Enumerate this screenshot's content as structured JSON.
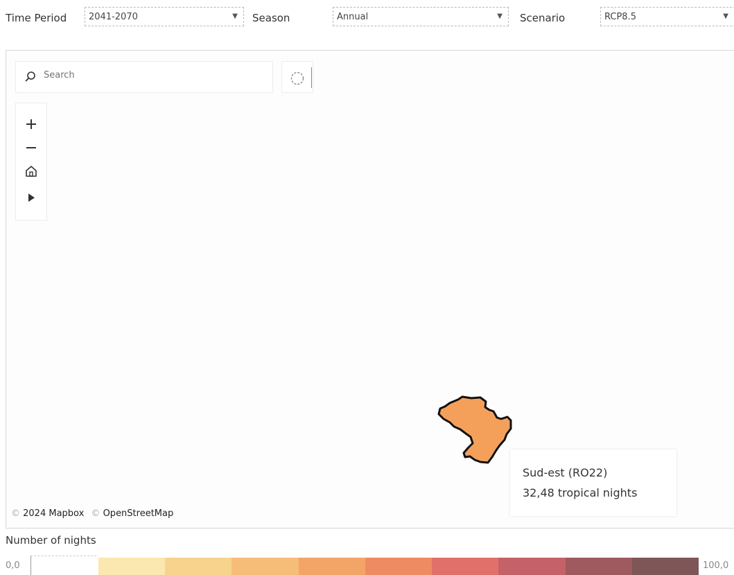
{
  "filters": {
    "time_period": {
      "label": "Time Period",
      "value": "2041-2070"
    },
    "season": {
      "label": "Season",
      "value": "Annual"
    },
    "scenario": {
      "label": "Scenario",
      "value": "RCP8.5"
    }
  },
  "map": {
    "search_placeholder": "Search",
    "region_fill_color": "#f5a05a",
    "region_outline_color": "#111111",
    "attribution": {
      "mapbox_prefix": "©",
      "mapbox": "2024 Mapbox",
      "osm_prefix": "©",
      "osm": "OpenStreetMap"
    }
  },
  "tooltip": {
    "region": "Sud-est (RO22)",
    "value_text": "32,48 tropical nights"
  },
  "legend": {
    "title": "Number of nights",
    "min": "0,0",
    "max": "100,0",
    "colors": [
      "#fbe7b0",
      "#f8d38e",
      "#f6bd78",
      "#f3a567",
      "#ee8b63",
      "#e1706a",
      "#c56168",
      "#9e5a5f",
      "#7e5658"
    ]
  }
}
